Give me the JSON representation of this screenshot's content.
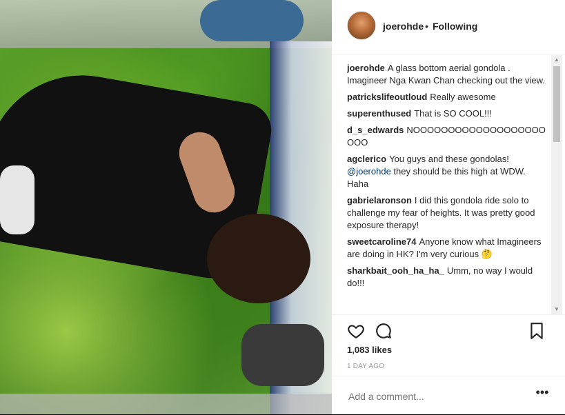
{
  "post": {
    "author": "joerohde",
    "separator": "•",
    "follow_status": "Following"
  },
  "comments": [
    {
      "user": "joerohde",
      "text": "A glass bottom aerial gondola . Imagineer Nga Kwan Chan checking out the view."
    },
    {
      "user": "patrickslifeoutloud",
      "text": "Really awesome"
    },
    {
      "user": "superenthused",
      "text": "That is SO COOL!!!"
    },
    {
      "user": "d_s_edwards",
      "text": "NOOOOOOOOOOOOOOOOOOOOOO"
    },
    {
      "user": "agclerico",
      "text": "You guys and these gondolas!",
      "mention": "@joerohde",
      "text_after": "they should be this high at WDW. Haha"
    },
    {
      "user": "gabrielaronson",
      "text": "I did this gondola ride solo to challenge my fear of heights. It was pretty good exposure therapy!"
    },
    {
      "user": "sweetcaroline74",
      "text": "Anyone know what Imagineers are doing in HK? I'm very curious 🤔"
    },
    {
      "user": "sharkbait_ooh_ha_ha_",
      "text": "Umm, no way I would do!!!"
    }
  ],
  "actions": {
    "like_icon": "heart-icon",
    "comment_icon": "speech-bubble-icon",
    "save_icon": "bookmark-icon"
  },
  "likes": "1,083 likes",
  "timestamp": "1 DAY AGO",
  "add_comment": {
    "placeholder": "Add a comment...",
    "more_label": "•••"
  },
  "scrollbar": {
    "up": "▲",
    "down": "▼"
  },
  "photo": {
    "alt": "Woman lying on glass floor of gondola over forest"
  }
}
